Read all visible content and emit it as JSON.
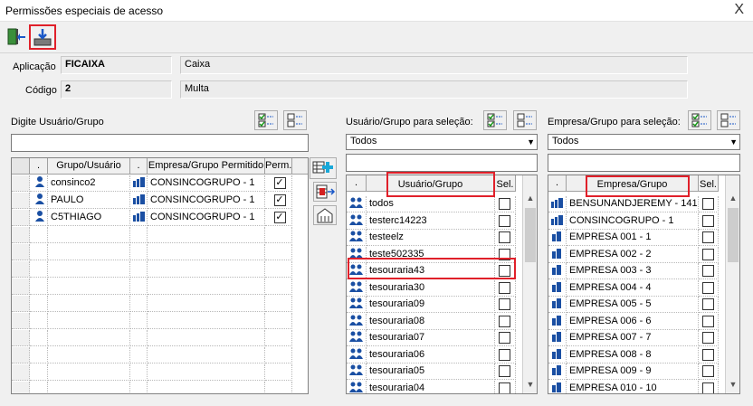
{
  "window": {
    "title": "Permissões especiais de acesso",
    "close": "X"
  },
  "toolbar": {
    "exit_icon": "exit-door-icon",
    "save_icon": "save-download-icon"
  },
  "app": {
    "aplicacao_label": "Aplicação",
    "aplicacao_code": "FICAIXA",
    "aplicacao_desc": "Caixa",
    "codigo_label": "Código",
    "codigo_value": "2",
    "codigo_desc": "Multa"
  },
  "left": {
    "search_label": "Digite Usuário/Grupo",
    "headers": [
      ".",
      "Grupo/Usuário",
      ".",
      "Empresa/Grupo Permitido",
      "Perm."
    ],
    "rows": [
      {
        "user": "consinco2",
        "empresa": "CONSINCOGRUPO - 1",
        "perm": true
      },
      {
        "user": "PAULO",
        "empresa": "CONSINCOGRUPO - 1",
        "perm": true
      },
      {
        "user": "C5THIAGO",
        "empresa": "CONSINCOGRUPO - 1",
        "perm": true
      }
    ]
  },
  "middle": {
    "label": "Usuário/Grupo para seleção:",
    "select_value": "Todos",
    "headers": [
      ".",
      "Usuário/Grupo",
      "Sel."
    ],
    "rows": [
      "todos",
      "testerc14223",
      "testeelz",
      "teste502335",
      "tesouraria43",
      "tesouraria30",
      "tesouraria09",
      "tesouraria08",
      "tesouraria07",
      "tesouraria06",
      "tesouraria05",
      "tesouraria04"
    ]
  },
  "right": {
    "label": "Empresa/Grupo para seleção:",
    "select_value": "Todos",
    "headers": [
      ".",
      "Empresa/Grupo",
      "Sel."
    ],
    "rows": [
      "BENSUNANDJEREMY - 141",
      "CONSINCOGRUPO - 1",
      "EMPRESA 001 - 1",
      "EMPRESA 002 - 2",
      "EMPRESA 003 - 3",
      "EMPRESA 004 - 4",
      "EMPRESA 005 - 5",
      "EMPRESA 006 - 6",
      "EMPRESA 007 - 7",
      "EMPRESA 008 - 8",
      "EMPRESA 009 - 9",
      "EMPRESA 010 - 10"
    ]
  },
  "colors": {
    "highlight": "#e0202a",
    "user_icon": "#1a4fa3"
  }
}
